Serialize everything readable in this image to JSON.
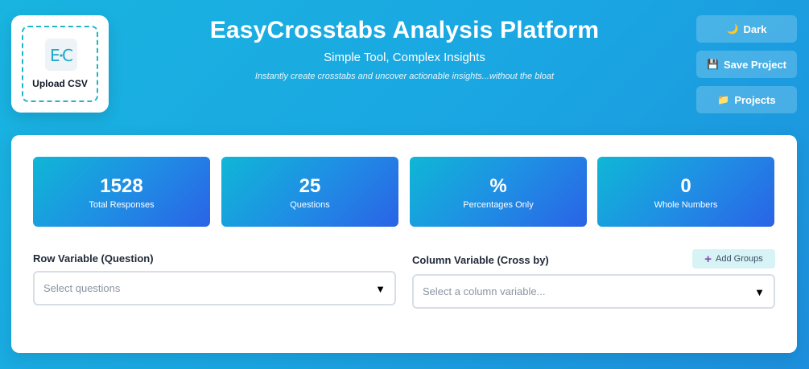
{
  "upload": {
    "label": "Upload CSV",
    "logo_text": "E·C"
  },
  "header": {
    "title": "EasyCrosstabs Analysis Platform",
    "subtitle": "Simple Tool, Complex Insights",
    "tagline": "Instantly create crosstabs and uncover actionable insights...without the bloat"
  },
  "top_buttons": {
    "dark": {
      "label": "Dark",
      "icon": "moon-icon",
      "glyph": "🌙"
    },
    "save": {
      "label": "Save Project",
      "icon": "floppy-disk-icon",
      "glyph": "💾"
    },
    "projects": {
      "label": "Projects",
      "icon": "folder-icon",
      "glyph": "📁"
    }
  },
  "stats": [
    {
      "value": "1528",
      "label": "Total Responses"
    },
    {
      "value": "25",
      "label": "Questions"
    },
    {
      "value": "%",
      "label": "Percentages Only"
    },
    {
      "value": "0",
      "label": "Whole Numbers"
    }
  ],
  "row_variable": {
    "label": "Row Variable (Question)",
    "placeholder": "Select questions"
  },
  "column_variable": {
    "label": "Column Variable (Cross by)",
    "placeholder": "Select a column variable...",
    "add_groups_label": "Add Groups"
  },
  "colors": {
    "background": "#1aa6e2",
    "card_gradient_start": "#0fb7d6",
    "card_gradient_end": "#2a63e6",
    "accent_teal": "#22b5c4"
  }
}
